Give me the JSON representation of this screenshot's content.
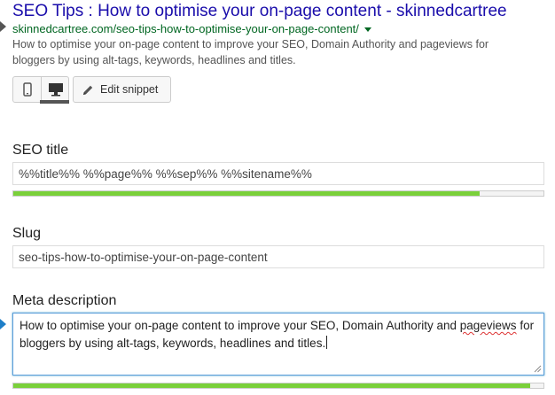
{
  "snippet_preview": {
    "title": "SEO Tips : How to optimise your on-page content - skinnedcartree",
    "url": "skinnedcartree.com/seo-tips-how-to-optimise-your-on-page-content/",
    "description": "How to optimise your on-page content to improve your SEO, Domain Authority and pageviews for bloggers by using alt-tags, keywords, headlines and titles."
  },
  "toolbar": {
    "mobile_icon": "mobile-phone-icon",
    "desktop_icon": "desktop-monitor-icon",
    "active_mode": "desktop",
    "edit_icon": "pencil-icon",
    "edit_label": "Edit snippet"
  },
  "seo_title": {
    "label": "SEO title",
    "value": "%%title%% %%page%% %%sep%% %%sitename%%",
    "progress": 0.88,
    "progress_color": "#7ad03a"
  },
  "slug": {
    "label": "Slug",
    "value": "seo-tips-how-to-optimise-your-on-page-content"
  },
  "meta_description": {
    "label": "Meta description",
    "value_part1": "How to optimise your on-page content to improve your SEO, Domain Authority and ",
    "value_spell": "pageviews",
    "value_part2": " for bloggers by using alt-tags, keywords, headlines and titles.",
    "progress": 0.975,
    "progress_color": "#7ad03a"
  },
  "colors": {
    "link_title": "#1a0dab",
    "url_green": "#006621",
    "focus_blue": "#5b9dd9"
  }
}
